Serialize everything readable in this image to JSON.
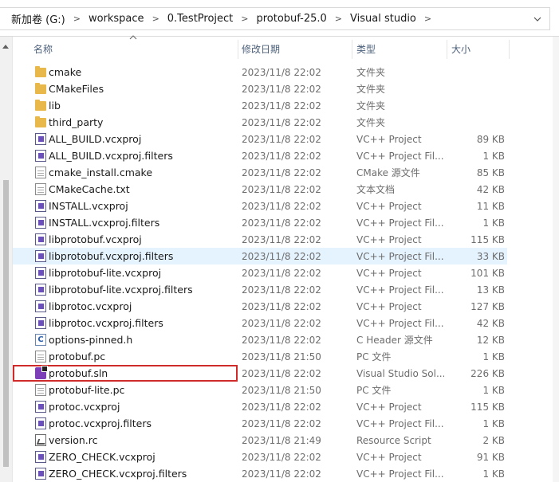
{
  "breadcrumb": {
    "items": [
      {
        "label": "新加卷 (G:)"
      },
      {
        "label": "workspace"
      },
      {
        "label": "0.TestProject"
      },
      {
        "label": "protobuf-25.0"
      },
      {
        "label": "Visual studio"
      }
    ],
    "separator": ">",
    "dropdown_icon": "chevron-down-icon"
  },
  "columns": {
    "name": "名称",
    "date": "修改日期",
    "type": "类型",
    "size": "大小"
  },
  "sort": {
    "column": "name",
    "direction": "ascending",
    "icon": "sort-up-caret-icon"
  },
  "files": [
    {
      "icon": "folder-icon",
      "name": "cmake",
      "date": "2023/11/8 22:02",
      "type": "文件夹",
      "size": ""
    },
    {
      "icon": "folder-icon",
      "name": "CMakeFiles",
      "date": "2023/11/8 22:02",
      "type": "文件夹",
      "size": ""
    },
    {
      "icon": "folder-icon",
      "name": "lib",
      "date": "2023/11/8 22:02",
      "type": "文件夹",
      "size": ""
    },
    {
      "icon": "folder-icon",
      "name": "third_party",
      "date": "2023/11/8 22:02",
      "type": "文件夹",
      "size": ""
    },
    {
      "icon": "vcxproj-icon",
      "name": "ALL_BUILD.vcxproj",
      "date": "2023/11/8 22:02",
      "type": "VC++ Project",
      "size": "89 KB"
    },
    {
      "icon": "vcxproj-icon",
      "name": "ALL_BUILD.vcxproj.filters",
      "date": "2023/11/8 22:02",
      "type": "VC++ Project Fil...",
      "size": "1 KB"
    },
    {
      "icon": "text-file-icon",
      "name": "cmake_install.cmake",
      "date": "2023/11/8 22:02",
      "type": "CMake 源文件",
      "size": "85 KB"
    },
    {
      "icon": "text-file-icon",
      "name": "CMakeCache.txt",
      "date": "2023/11/8 22:02",
      "type": "文本文档",
      "size": "42 KB"
    },
    {
      "icon": "vcxproj-icon",
      "name": "INSTALL.vcxproj",
      "date": "2023/11/8 22:02",
      "type": "VC++ Project",
      "size": "11 KB"
    },
    {
      "icon": "vcxproj-icon",
      "name": "INSTALL.vcxproj.filters",
      "date": "2023/11/8 22:02",
      "type": "VC++ Project Fil...",
      "size": "1 KB"
    },
    {
      "icon": "vcxproj-icon",
      "name": "libprotobuf.vcxproj",
      "date": "2023/11/8 22:02",
      "type": "VC++ Project",
      "size": "115 KB"
    },
    {
      "icon": "vcxproj-icon",
      "name": "libprotobuf.vcxproj.filters",
      "date": "2023/11/8 22:02",
      "type": "VC++ Project Fil...",
      "size": "33 KB",
      "hovered": true
    },
    {
      "icon": "vcxproj-icon",
      "name": "libprotobuf-lite.vcxproj",
      "date": "2023/11/8 22:02",
      "type": "VC++ Project",
      "size": "101 KB"
    },
    {
      "icon": "vcxproj-icon",
      "name": "libprotobuf-lite.vcxproj.filters",
      "date": "2023/11/8 22:02",
      "type": "VC++ Project Fil...",
      "size": "13 KB"
    },
    {
      "icon": "vcxproj-icon",
      "name": "libprotoc.vcxproj",
      "date": "2023/11/8 22:02",
      "type": "VC++ Project",
      "size": "127 KB"
    },
    {
      "icon": "vcxproj-icon",
      "name": "libprotoc.vcxproj.filters",
      "date": "2023/11/8 22:02",
      "type": "VC++ Project Fil...",
      "size": "42 KB"
    },
    {
      "icon": "c-header-icon",
      "name": "options-pinned.h",
      "date": "2023/11/8 22:02",
      "type": "C Header 源文件",
      "size": "12 KB"
    },
    {
      "icon": "text-file-icon",
      "name": "protobuf.pc",
      "date": "2023/11/8 21:50",
      "type": "PC 文件",
      "size": "1 KB"
    },
    {
      "icon": "visual-studio-solution-icon",
      "name": "protobuf.sln",
      "date": "2023/11/8 22:02",
      "type": "Visual Studio Sol...",
      "size": "226 KB",
      "highlighted": true
    },
    {
      "icon": "text-file-icon",
      "name": "protobuf-lite.pc",
      "date": "2023/11/8 21:50",
      "type": "PC 文件",
      "size": "1 KB"
    },
    {
      "icon": "vcxproj-icon",
      "name": "protoc.vcxproj",
      "date": "2023/11/8 22:02",
      "type": "VC++ Project",
      "size": "115 KB"
    },
    {
      "icon": "vcxproj-icon",
      "name": "protoc.vcxproj.filters",
      "date": "2023/11/8 22:02",
      "type": "VC++ Project Fil...",
      "size": "1 KB"
    },
    {
      "icon": "resource-script-icon",
      "name": "version.rc",
      "date": "2023/11/8 21:49",
      "type": "Resource Script",
      "size": "2 KB"
    },
    {
      "icon": "vcxproj-icon",
      "name": "ZERO_CHECK.vcxproj",
      "date": "2023/11/8 22:02",
      "type": "VC++ Project",
      "size": "91 KB"
    },
    {
      "icon": "vcxproj-icon",
      "name": "ZERO_CHECK.vcxproj.filters",
      "date": "2023/11/8 22:02",
      "type": "VC++ Project Fil...",
      "size": "1 KB"
    }
  ],
  "colors": {
    "hover_row": "#e5f3ff",
    "highlight_box": "#d02b2b",
    "header_text": "#4c607a",
    "folder": "#e8b84a"
  }
}
